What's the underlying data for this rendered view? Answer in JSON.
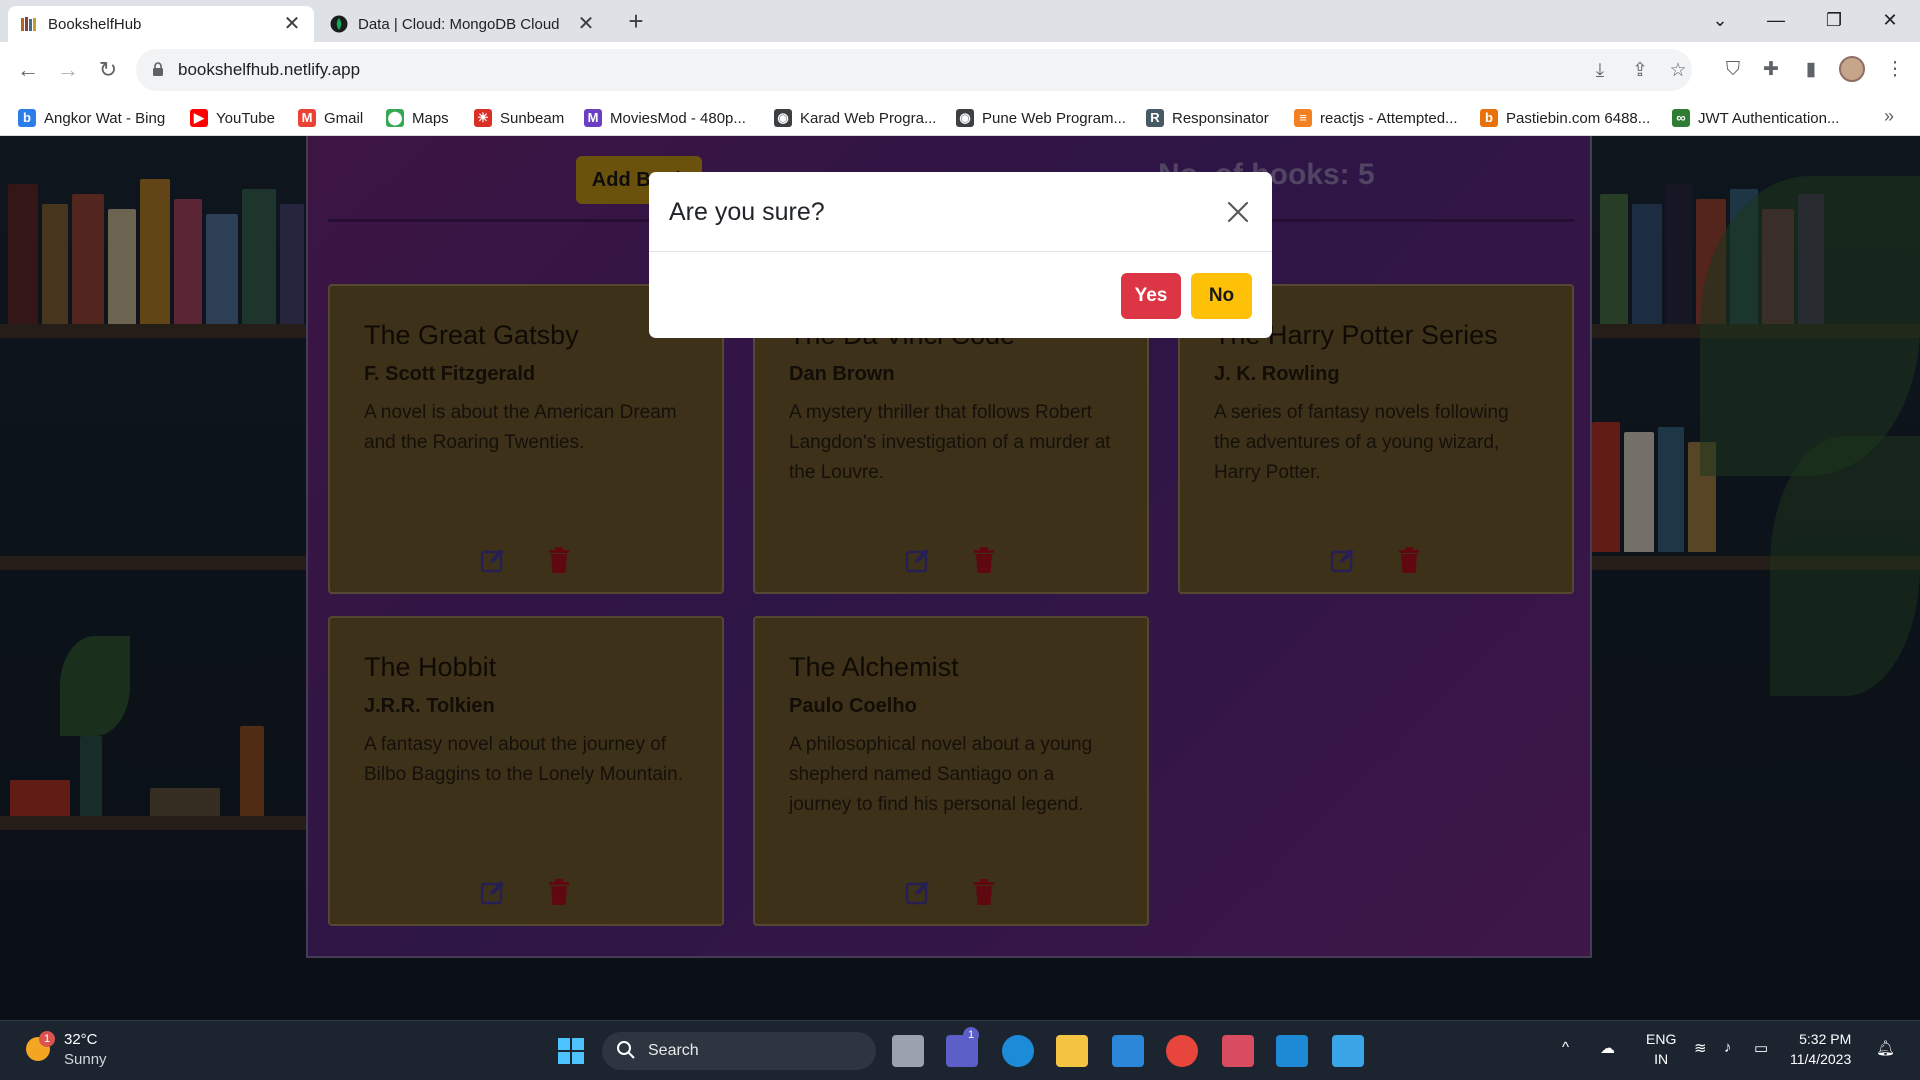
{
  "browser": {
    "tabs": [
      {
        "title": "BookshelfHub",
        "close": "✕",
        "active": true
      },
      {
        "title": "Data | Cloud: MongoDB Cloud",
        "close": "✕",
        "active": false
      }
    ],
    "new_tab": "+",
    "window_controls": {
      "dropdown": "⌄",
      "minimize": "—",
      "restore": "❐",
      "close": "✕"
    },
    "nav": {
      "back": "←",
      "forward": "→",
      "reload": "↻"
    },
    "url": "bookshelfhub.netlify.app",
    "bookmarks": [
      {
        "label": "Angkor Wat - Bing",
        "icon": "bing-icon",
        "color": "#2b7de9"
      },
      {
        "label": "YouTube",
        "icon": "youtube-icon",
        "color": "#ff0000"
      },
      {
        "label": "Gmail",
        "icon": "gmail-icon",
        "color": "#ea4335"
      },
      {
        "label": "Maps",
        "icon": "maps-icon",
        "color": "#34a853"
      },
      {
        "label": "Sunbeam",
        "icon": "sunbeam-icon",
        "color": "#d93025"
      },
      {
        "label": "MoviesMod - 480p...",
        "icon": "moviesmod-icon",
        "color": "#6a3fc1"
      },
      {
        "label": "Karad Web Progra...",
        "icon": "globe-icon",
        "color": "#3c4043"
      },
      {
        "label": "Pune Web Program...",
        "icon": "globe-icon",
        "color": "#3c4043"
      },
      {
        "label": "Responsinator",
        "icon": "responsinator-icon",
        "color": "#455a64"
      },
      {
        "label": "reactjs - Attempted...",
        "icon": "stackoverflow-icon",
        "color": "#f48024"
      },
      {
        "label": "Pastiebin.com 6488...",
        "icon": "pastiebin-icon",
        "color": "#e8710a"
      },
      {
        "label": "JWT Authentication...",
        "icon": "jwt-icon",
        "color": "#2e7d32"
      }
    ],
    "bookmarks_more": "»"
  },
  "app": {
    "add_button": "Add Book",
    "book_count": "No. of books: 5",
    "books": [
      {
        "title": "The Great Gatsby",
        "author": "F. Scott Fitzgerald",
        "description": "A novel is about the American Dream and the Roaring Twenties."
      },
      {
        "title": "The Da Vinci Code",
        "author": "Dan Brown",
        "description": "A mystery thriller that follows Robert Langdon's investigation of a murder at the Louvre."
      },
      {
        "title": "The Harry Potter Series",
        "author": "J. K. Rowling",
        "description": "A series of fantasy novels following the adventures of a young wizard, Harry Potter."
      },
      {
        "title": "The Hobbit",
        "author": "J.R.R. Tolkien",
        "description": "A fantasy novel about the journey of Bilbo Baggins to the Lonely Mountain."
      },
      {
        "title": "The Alchemist",
        "author": "Paulo Coelho",
        "description": "A philosophical novel about a young shepherd named Santiago on a journey to find his personal legend."
      }
    ],
    "colors": {
      "edit": "#4c3fa6",
      "delete": "#c0111f",
      "card": "#7a6235"
    }
  },
  "modal": {
    "title": "Are you sure?",
    "yes": "Yes",
    "no": "No",
    "colors": {
      "yes": "#dc3545",
      "no": "#ffc107"
    }
  },
  "taskbar": {
    "weather_temp": "32°C",
    "weather_desc": "Sunny",
    "weather_badge": "1",
    "search_label": "Search",
    "teams_badge": "1",
    "lang_top": "ENG",
    "lang_bottom": "IN",
    "time": "5:32 PM",
    "date": "11/4/2023",
    "tray_chevron": "^"
  }
}
